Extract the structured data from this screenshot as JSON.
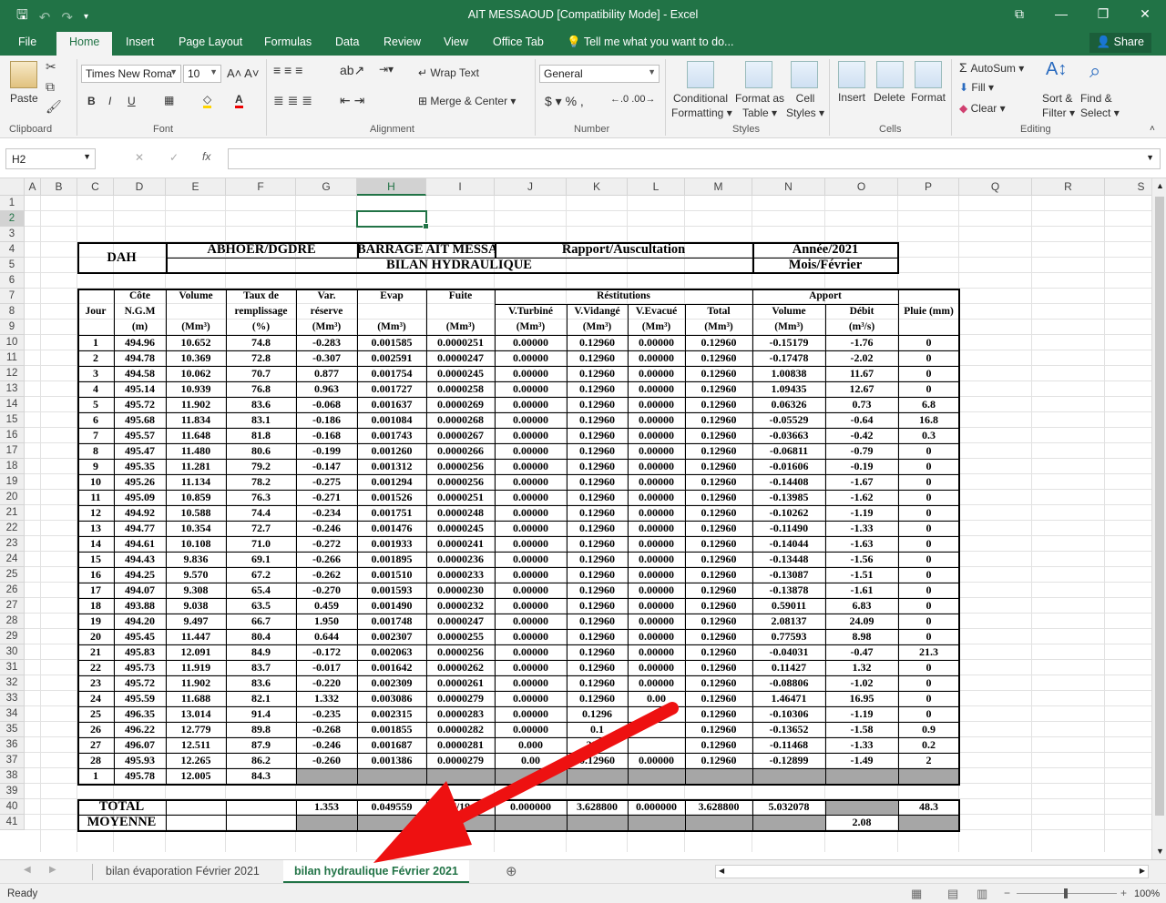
{
  "window": {
    "title": "AIT MESSAOUD  [Compatibility Mode] - Excel",
    "share_label": "Share",
    "qat_icons": [
      "save-icon",
      "undo-icon",
      "redo-icon",
      "customize-icon"
    ]
  },
  "ribbon_tabs": [
    "File",
    "Home",
    "Insert",
    "Page Layout",
    "Formulas",
    "Data",
    "Review",
    "View",
    "Office Tab",
    "Tell me what you want to do..."
  ],
  "ribbon": {
    "clipboard": {
      "label": "Clipboard",
      "paste": "Paste"
    },
    "font": {
      "label": "Font",
      "family": "Times New Roma",
      "size": "10"
    },
    "alignment": {
      "label": "Alignment",
      "wrap_text": "Wrap Text",
      "merge_center": "Merge & Center"
    },
    "number": {
      "label": "Number",
      "format": "General"
    },
    "styles": {
      "label": "Styles",
      "conditional": [
        "Conditional",
        "Formatting"
      ],
      "format_as": [
        "Format as",
        "Table"
      ],
      "cell_styles": [
        "Cell",
        "Styles"
      ]
    },
    "cells": {
      "label": "Cells",
      "insert": "Insert",
      "delete": "Delete",
      "format": "Format"
    },
    "editing": {
      "label": "Editing",
      "autosum": "AutoSum",
      "fill": "Fill",
      "clear": "Clear",
      "sort": [
        "Sort &",
        "Filter"
      ],
      "find": [
        "Find &",
        "Select"
      ]
    }
  },
  "formula_bar": {
    "name_box": "H2",
    "cancel": "✕",
    "enter": "✓",
    "fx": "fx",
    "formula": ""
  },
  "grid": {
    "columns": [
      "A",
      "B",
      "C",
      "D",
      "E",
      "F",
      "G",
      "H",
      "I",
      "J",
      "K",
      "L",
      "M",
      "N",
      "O",
      "P",
      "Q",
      "R",
      "S"
    ],
    "rows": [
      1,
      2,
      3,
      4,
      5,
      6,
      7,
      8,
      9,
      10,
      11,
      12,
      13,
      14,
      15,
      16,
      17,
      18,
      19,
      20,
      21,
      22,
      23,
      24,
      25,
      26,
      27,
      28,
      29,
      30,
      31,
      32,
      33,
      34,
      35,
      36,
      37,
      38,
      39,
      40,
      41
    ],
    "selected_col": "H",
    "selected_row": 2
  },
  "sheet": {
    "header": {
      "dah": "DAH",
      "agency": "ABHOER/DGDRE",
      "barrage": "BARRAGE AIT MESSAOUUD",
      "rapport": "Rapport/Auscultation",
      "annee": "Année/2021",
      "bilan": "BILAN HYDRAULIQUE",
      "mois": "Mois/Février"
    },
    "col_headers": {
      "jour": "Jour",
      "cote": [
        "Côte",
        "N.G.M",
        "(m)"
      ],
      "volume": [
        "Volume",
        "(Mm³)"
      ],
      "taux": [
        "Taux de",
        "remplissage",
        "(%)"
      ],
      "var": [
        "Var.",
        "réserve",
        "(Mm³)"
      ],
      "evap": [
        "Evap",
        "(Mm³)"
      ],
      "fuite": [
        "Fuite",
        "(Mm³)"
      ],
      "restitutions": "Réstitutions",
      "vturbine": [
        "V.Turbiné",
        "(Mm³)"
      ],
      "vvidange": [
        "V.Vidangé",
        "(Mm³)"
      ],
      "vevacue": [
        "V.Evacué",
        "(Mm³)"
      ],
      "total": [
        "Total",
        "(Mm³)"
      ],
      "apport": "Apport",
      "apport_volume": [
        "Volume",
        "(Mm³)"
      ],
      "debit": [
        "Débit",
        "(m³/s)"
      ],
      "pluie": "Pluie (mm)"
    },
    "rows": [
      [
        "1",
        "494.96",
        "10.652",
        "74.8",
        "-0.283",
        "0.001585",
        "0.0000251",
        "0.00000",
        "0.12960",
        "0.00000",
        "0.12960",
        "-0.15179",
        "-1.76",
        "0"
      ],
      [
        "2",
        "494.78",
        "10.369",
        "72.8",
        "-0.307",
        "0.002591",
        "0.0000247",
        "0.00000",
        "0.12960",
        "0.00000",
        "0.12960",
        "-0.17478",
        "-2.02",
        "0"
      ],
      [
        "3",
        "494.58",
        "10.062",
        "70.7",
        "0.877",
        "0.001754",
        "0.0000245",
        "0.00000",
        "0.12960",
        "0.00000",
        "0.12960",
        "1.00838",
        "11.67",
        "0"
      ],
      [
        "4",
        "495.14",
        "10.939",
        "76.8",
        "0.963",
        "0.001727",
        "0.0000258",
        "0.00000",
        "0.12960",
        "0.00000",
        "0.12960",
        "1.09435",
        "12.67",
        "0"
      ],
      [
        "5",
        "495.72",
        "11.902",
        "83.6",
        "-0.068",
        "0.001637",
        "0.0000269",
        "0.00000",
        "0.12960",
        "0.00000",
        "0.12960",
        "0.06326",
        "0.73",
        "6.8"
      ],
      [
        "6",
        "495.68",
        "11.834",
        "83.1",
        "-0.186",
        "0.001084",
        "0.0000268",
        "0.00000",
        "0.12960",
        "0.00000",
        "0.12960",
        "-0.05529",
        "-0.64",
        "16.8"
      ],
      [
        "7",
        "495.57",
        "11.648",
        "81.8",
        "-0.168",
        "0.001743",
        "0.0000267",
        "0.00000",
        "0.12960",
        "0.00000",
        "0.12960",
        "-0.03663",
        "-0.42",
        "0.3"
      ],
      [
        "8",
        "495.47",
        "11.480",
        "80.6",
        "-0.199",
        "0.001260",
        "0.0000266",
        "0.00000",
        "0.12960",
        "0.00000",
        "0.12960",
        "-0.06811",
        "-0.79",
        "0"
      ],
      [
        "9",
        "495.35",
        "11.281",
        "79.2",
        "-0.147",
        "0.001312",
        "0.0000256",
        "0.00000",
        "0.12960",
        "0.00000",
        "0.12960",
        "-0.01606",
        "-0.19",
        "0"
      ],
      [
        "10",
        "495.26",
        "11.134",
        "78.2",
        "-0.275",
        "0.001294",
        "0.0000256",
        "0.00000",
        "0.12960",
        "0.00000",
        "0.12960",
        "-0.14408",
        "-1.67",
        "0"
      ],
      [
        "11",
        "495.09",
        "10.859",
        "76.3",
        "-0.271",
        "0.001526",
        "0.0000251",
        "0.00000",
        "0.12960",
        "0.00000",
        "0.12960",
        "-0.13985",
        "-1.62",
        "0"
      ],
      [
        "12",
        "494.92",
        "10.588",
        "74.4",
        "-0.234",
        "0.001751",
        "0.0000248",
        "0.00000",
        "0.12960",
        "0.00000",
        "0.12960",
        "-0.10262",
        "-1.19",
        "0"
      ],
      [
        "13",
        "494.77",
        "10.354",
        "72.7",
        "-0.246",
        "0.001476",
        "0.0000245",
        "0.00000",
        "0.12960",
        "0.00000",
        "0.12960",
        "-0.11490",
        "-1.33",
        "0"
      ],
      [
        "14",
        "494.61",
        "10.108",
        "71.0",
        "-0.272",
        "0.001933",
        "0.0000241",
        "0.00000",
        "0.12960",
        "0.00000",
        "0.12960",
        "-0.14044",
        "-1.63",
        "0"
      ],
      [
        "15",
        "494.43",
        "9.836",
        "69.1",
        "-0.266",
        "0.001895",
        "0.0000236",
        "0.00000",
        "0.12960",
        "0.00000",
        "0.12960",
        "-0.13448",
        "-1.56",
        "0"
      ],
      [
        "16",
        "494.25",
        "9.570",
        "67.2",
        "-0.262",
        "0.001510",
        "0.0000233",
        "0.00000",
        "0.12960",
        "0.00000",
        "0.12960",
        "-0.13087",
        "-1.51",
        "0"
      ],
      [
        "17",
        "494.07",
        "9.308",
        "65.4",
        "-0.270",
        "0.001593",
        "0.0000230",
        "0.00000",
        "0.12960",
        "0.00000",
        "0.12960",
        "-0.13878",
        "-1.61",
        "0"
      ],
      [
        "18",
        "493.88",
        "9.038",
        "63.5",
        "0.459",
        "0.001490",
        "0.0000232",
        "0.00000",
        "0.12960",
        "0.00000",
        "0.12960",
        "0.59011",
        "6.83",
        "0"
      ],
      [
        "19",
        "494.20",
        "9.497",
        "66.7",
        "1.950",
        "0.001748",
        "0.0000247",
        "0.00000",
        "0.12960",
        "0.00000",
        "0.12960",
        "2.08137",
        "24.09",
        "0"
      ],
      [
        "20",
        "495.45",
        "11.447",
        "80.4",
        "0.644",
        "0.002307",
        "0.0000255",
        "0.00000",
        "0.12960",
        "0.00000",
        "0.12960",
        "0.77593",
        "8.98",
        "0"
      ],
      [
        "21",
        "495.83",
        "12.091",
        "84.9",
        "-0.172",
        "0.002063",
        "0.0000256",
        "0.00000",
        "0.12960",
        "0.00000",
        "0.12960",
        "-0.04031",
        "-0.47",
        "21.3"
      ],
      [
        "22",
        "495.73",
        "11.919",
        "83.7",
        "-0.017",
        "0.001642",
        "0.0000262",
        "0.00000",
        "0.12960",
        "0.00000",
        "0.12960",
        "0.11427",
        "1.32",
        "0"
      ],
      [
        "23",
        "495.72",
        "11.902",
        "83.6",
        "-0.220",
        "0.002309",
        "0.0000261",
        "0.00000",
        "0.12960",
        "0.00000",
        "0.12960",
        "-0.08806",
        "-1.02",
        "0"
      ],
      [
        "24",
        "495.59",
        "11.688",
        "82.1",
        "1.332",
        "0.003086",
        "0.0000279",
        "0.00000",
        "0.12960",
        "0.00",
        "0.12960",
        "1.46471",
        "16.95",
        "0"
      ],
      [
        "25",
        "496.35",
        "13.014",
        "91.4",
        "-0.235",
        "0.002315",
        "0.0000283",
        "0.00000",
        "0.1296",
        "",
        "0.12960",
        "-0.10306",
        "-1.19",
        "0"
      ],
      [
        "26",
        "496.22",
        "12.779",
        "89.8",
        "-0.268",
        "0.001855",
        "0.0000282",
        "0.00000",
        "0.1",
        "",
        "0.12960",
        "-0.13652",
        "-1.58",
        "0.9"
      ],
      [
        "27",
        "496.07",
        "12.511",
        "87.9",
        "-0.246",
        "0.001687",
        "0.0000281",
        "0.000",
        "2960",
        "",
        "0.12960",
        "-0.11468",
        "-1.33",
        "0.2"
      ],
      [
        "28",
        "495.93",
        "12.265",
        "86.2",
        "-0.260",
        "0.001386",
        "0.0000279",
        "0.00",
        "0.12960",
        "0.00000",
        "0.12960",
        "-0.12899",
        "-1.49",
        "2"
      ],
      [
        "1",
        "495.78",
        "12.005",
        "84.3",
        "",
        "",
        "",
        "",
        "",
        "",
        "",
        "",
        "",
        ""
      ]
    ],
    "total": {
      "label": "TOTAL",
      "var": "1.353",
      "evap": "0.049559",
      "fuite": "7/19",
      "vturbine": "0.000000",
      "vvidange": "3.628800",
      "vevacue": "0.000000",
      "total": "3.628800",
      "apport": "5.032078",
      "pluie": "48.3"
    },
    "moyenne": {
      "label": "MOYENNE",
      "debit": "2.08"
    }
  },
  "sheet_tabs": [
    "bilan évaporation Février 2021",
    "bilan hydraulique Février 2021"
  ],
  "status": {
    "ready": "Ready",
    "zoom": "100%"
  }
}
